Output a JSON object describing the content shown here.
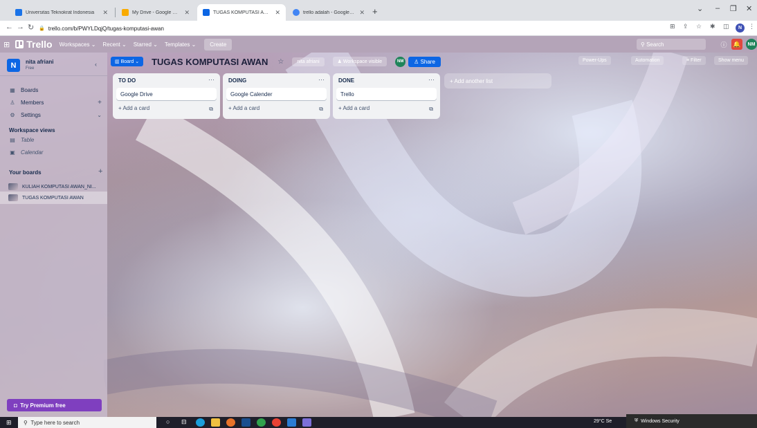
{
  "browser": {
    "tabs": [
      {
        "title": "Universitas Teknokrat Indonesia",
        "color": "#1a73e8"
      },
      {
        "title": "My Drive - Google Drive",
        "color": "#f9ab00"
      },
      {
        "title": "TUGAS KOMPUTASI AWAN | Trello",
        "color": "#0c66e4"
      },
      {
        "title": "trello adalah - Google Search",
        "color": "#4285f4"
      }
    ],
    "url": "trello.com/b/PWYLDqjQ/tugas-komputasi-awan",
    "profile_initial": "N"
  },
  "header": {
    "logo": "Trello",
    "nav": [
      "Workspaces",
      "Recent",
      "Starred",
      "Templates"
    ],
    "create": "Create",
    "search_placeholder": "Search",
    "avatar": "NM"
  },
  "sidebar": {
    "workspace_initial": "N",
    "workspace_name": "nita afriani",
    "workspace_plan": "Free",
    "items": [
      {
        "label": "Boards"
      },
      {
        "label": "Members"
      },
      {
        "label": "Settings"
      }
    ],
    "views_heading": "Workspace views",
    "views": [
      {
        "label": "Table"
      },
      {
        "label": "Calendar"
      }
    ],
    "boards_heading": "Your boards",
    "boards": [
      {
        "label": "KULIAH KOMPUTASI AWAN_NI..."
      },
      {
        "label": "TUGAS KOMPUTASI AWAN"
      }
    ],
    "premium": "Try Premium free"
  },
  "board": {
    "switcher": "Board",
    "title": "TUGAS KOMPUTASI AWAN",
    "member": "nita afriani",
    "visibility": "Workspace visible",
    "avatar": "NM",
    "share": "Share",
    "power_ups": "Power-Ups",
    "automation": "Automation",
    "filter": "Filter",
    "show_menu": "Show menu",
    "lists": [
      {
        "title": "TO DO",
        "cards": [
          "Google Drive"
        ],
        "add": "+ Add a card"
      },
      {
        "title": "DOING",
        "cards": [
          "Google Calender"
        ],
        "add": "+ Add a card"
      },
      {
        "title": "DONE",
        "cards": [
          "Trello"
        ],
        "add": "+ Add a card"
      }
    ],
    "add_list": "+ Add another list"
  },
  "taskbar": {
    "search_placeholder": "Type here to search",
    "weather": "29°C Se",
    "notification": "Windows Security"
  }
}
